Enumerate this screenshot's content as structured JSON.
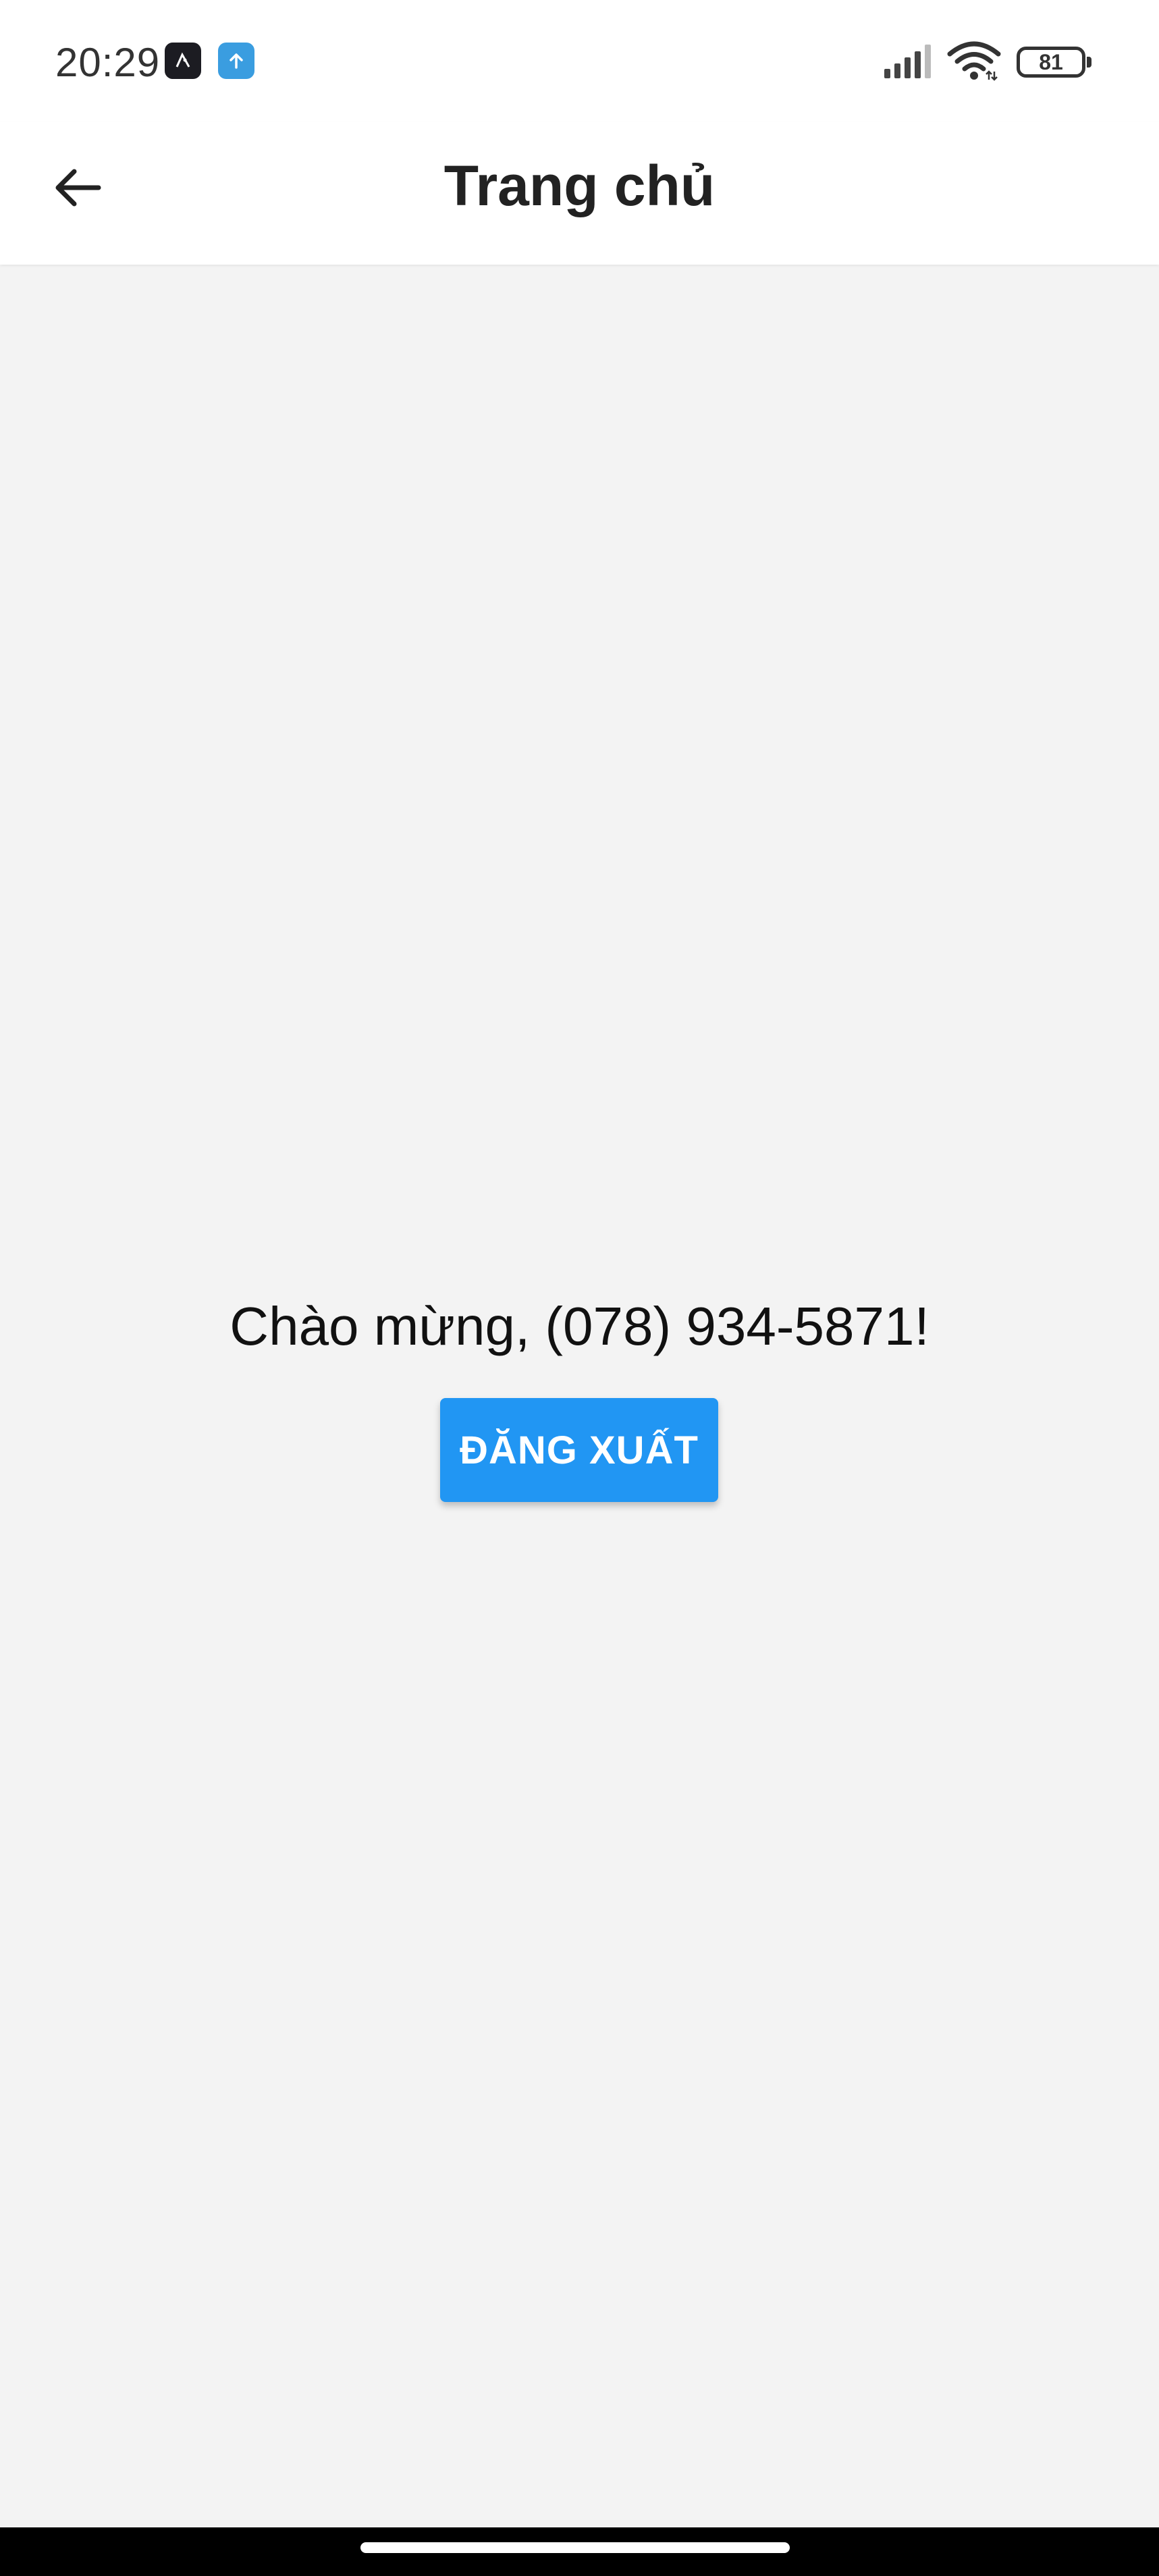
{
  "status_bar": {
    "time": "20:29",
    "notification_icons": [
      "app-notification-icon",
      "upload-notification-icon"
    ],
    "battery_level": "81"
  },
  "app_bar": {
    "back_icon": "arrow-left-icon",
    "title": "Trang chủ"
  },
  "main": {
    "welcome_text": "Chào mừng, (078) 934-5871!",
    "logout_label": "ĐĂNG XUẤT"
  },
  "colors": {
    "accent": "#2196f3",
    "background": "#f3f3f3",
    "app_bar": "#ffffff"
  }
}
